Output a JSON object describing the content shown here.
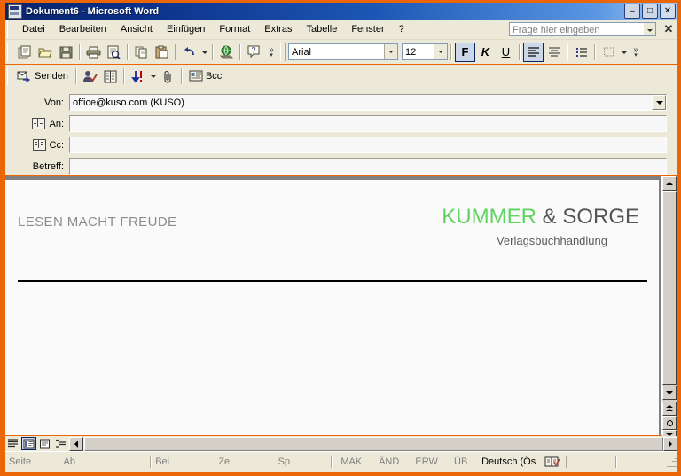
{
  "window": {
    "title": "Dokument6 - Microsoft Word",
    "icon": "word-document-icon",
    "minimize": "–",
    "maximize": "□",
    "close": "✕"
  },
  "menubar": {
    "items": [
      {
        "label": "Datei",
        "name": "menu-datei"
      },
      {
        "label": "Bearbeiten",
        "name": "menu-bearbeiten"
      },
      {
        "label": "Ansicht",
        "name": "menu-ansicht"
      },
      {
        "label": "Einfügen",
        "name": "menu-einfuegen"
      },
      {
        "label": "Format",
        "name": "menu-format"
      },
      {
        "label": "Extras",
        "name": "menu-extras"
      },
      {
        "label": "Tabelle",
        "name": "menu-tabelle"
      },
      {
        "label": "Fenster",
        "name": "menu-fenster"
      },
      {
        "label": "?",
        "name": "menu-hilfe"
      }
    ],
    "ask_placeholder": "Frage hier eingeben",
    "close_doc": "✕"
  },
  "toolbar_standard": {
    "buttons": [
      {
        "name": "new-document-icon",
        "title": "Neu"
      },
      {
        "name": "open-folder-icon",
        "title": "Öffnen"
      },
      {
        "name": "save-disk-icon",
        "title": "Speichern"
      },
      {
        "name": "print-icon",
        "title": "Drucken"
      },
      {
        "name": "print-preview-icon",
        "title": "Seitenansicht"
      },
      {
        "name": "copy-icon",
        "title": "Kopieren"
      },
      {
        "name": "paste-icon",
        "title": "Einfügen"
      },
      {
        "name": "undo-icon",
        "title": "Rückgängig"
      },
      {
        "name": "insert-hyperlink-icon",
        "title": "Hyperlink einfügen"
      },
      {
        "name": "help-icon",
        "title": "Hilfe"
      }
    ],
    "overflow": "»"
  },
  "toolbar_format": {
    "font_name": "Arial",
    "font_size": "12",
    "bold": "F",
    "italic": "K",
    "underline": "U",
    "align_left": "align-left-icon",
    "align_center": "align-center-icon",
    "bullets": "bullet-list-icon",
    "borders": "borders-icon",
    "overflow": "»"
  },
  "toolbar_mail": {
    "send_label": "Senden",
    "check_names": "check-names-icon",
    "address_book": "address-book-icon",
    "priority": "priority-icon",
    "attach": "attach-paperclip-icon",
    "bcc_label": "Bcc"
  },
  "mail_header": {
    "fields": [
      {
        "label": "Von:",
        "value": "office@kuso.com    (KUSO)",
        "name": "from-field",
        "icon": null,
        "dropdown": true
      },
      {
        "label": "An:",
        "value": "",
        "name": "to-field",
        "icon": "address-book-icon",
        "dropdown": false
      },
      {
        "label": "Cc:",
        "value": "",
        "name": "cc-field",
        "icon": "address-book-icon",
        "dropdown": false
      },
      {
        "label": "Betreff:",
        "value": "",
        "name": "subject-field",
        "icon": null,
        "dropdown": false
      }
    ]
  },
  "document": {
    "tagline": "LESEN MACHT FREUDE",
    "brand_green": "KUMMER",
    "brand_dark": " & SORGE",
    "subtitle": "Verlagsbuchhandlung",
    "colors": {
      "brand_green": "#5fd35f",
      "brand_dark": "#555555",
      "tagline_gray": "#8c8c8c"
    }
  },
  "view_bar": {
    "buttons": [
      {
        "name": "view-normal",
        "label": "normal-view-icon",
        "selected": false
      },
      {
        "name": "view-weblayout",
        "label": "web-layout-icon",
        "selected": true
      },
      {
        "name": "view-printlayout",
        "label": "print-layout-icon",
        "selected": false
      },
      {
        "name": "view-outline",
        "label": "outline-view-icon",
        "selected": false
      }
    ]
  },
  "statusbar": {
    "items": [
      {
        "label": "Seite",
        "name": "status-page",
        "active": false
      },
      {
        "label": "Ab",
        "name": "status-section",
        "active": false
      },
      {
        "label": "Bei",
        "name": "status-at",
        "active": false
      },
      {
        "label": "Ze",
        "name": "status-line",
        "active": false
      },
      {
        "label": "Sp",
        "name": "status-column",
        "active": false
      },
      {
        "label": "MAK",
        "name": "status-mak",
        "active": false
      },
      {
        "label": "ÄND",
        "name": "status-aend",
        "active": false
      },
      {
        "label": "ERW",
        "name": "status-erw",
        "active": false
      },
      {
        "label": "ÜB",
        "name": "status-ueb",
        "active": false
      },
      {
        "label": "Deutsch (Ös",
        "name": "status-language",
        "active": true
      }
    ],
    "spellcheck_icon": "spellcheck-book-icon"
  }
}
